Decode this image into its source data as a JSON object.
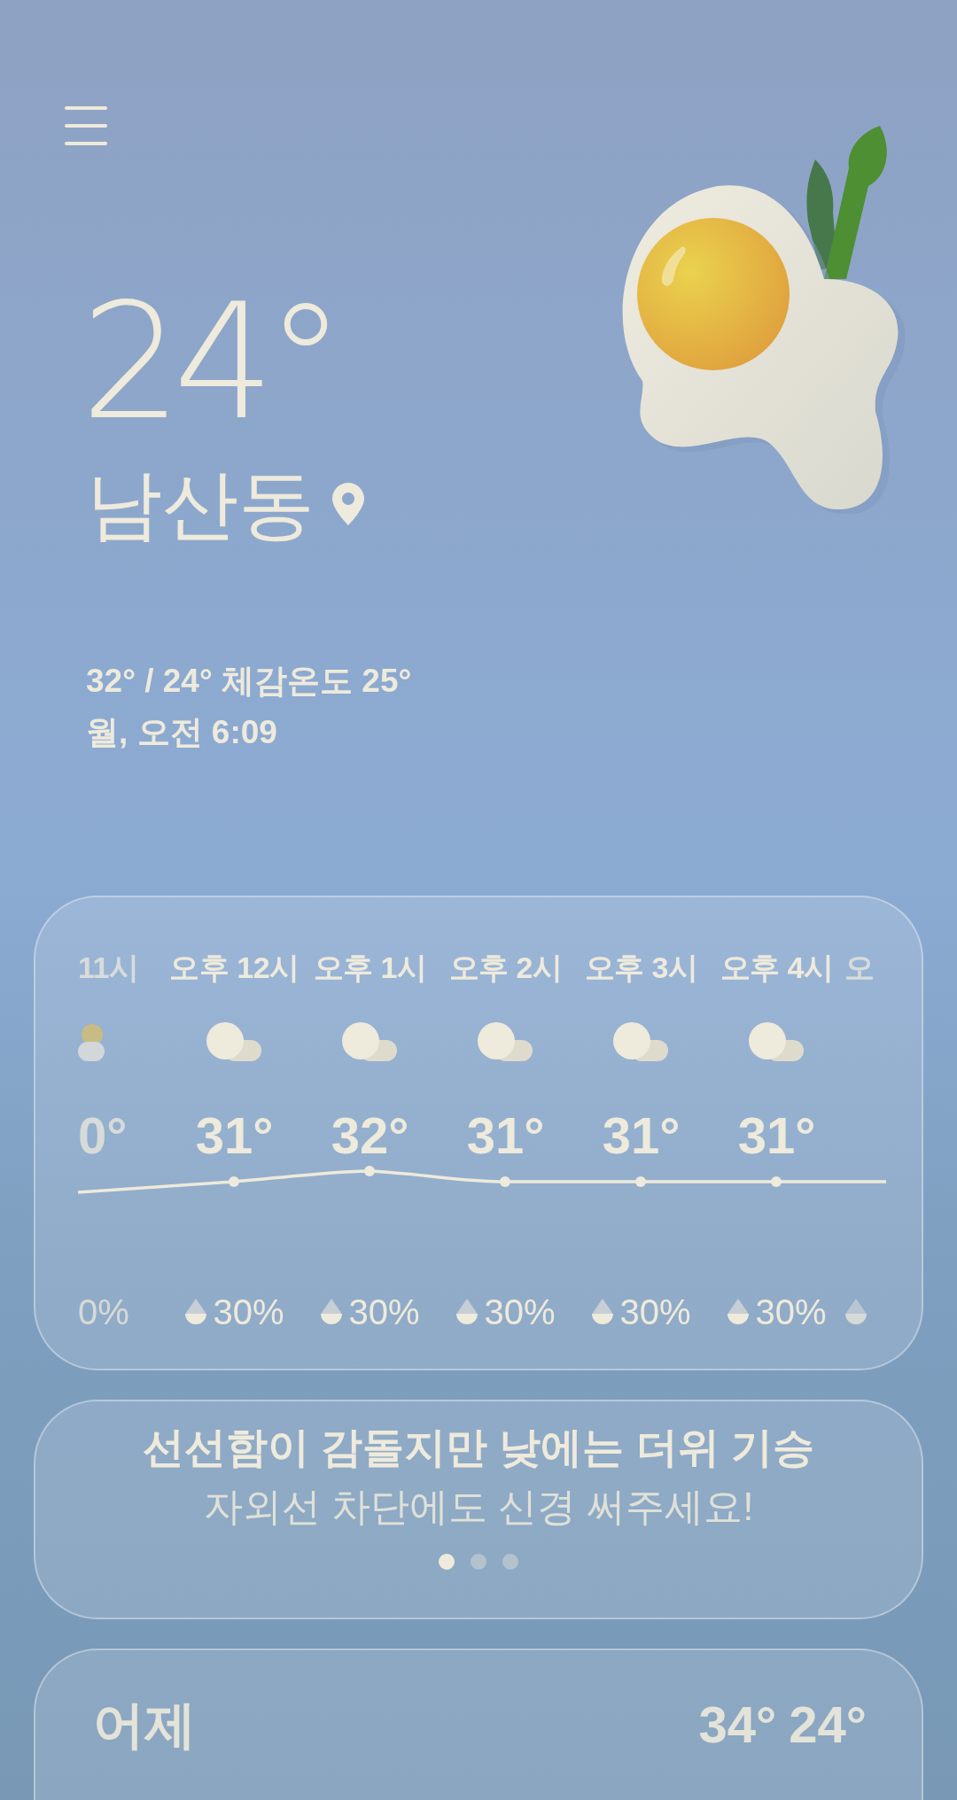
{
  "current": {
    "temperature": "24°",
    "location": "남산동",
    "high_low_feels": "32° / 24° 체감온도 25°",
    "updated": "월, 오전 6:09"
  },
  "hourly": [
    {
      "kind": "partlycloudy",
      "time": "11시",
      "temp": "0°",
      "precip": "0%"
    },
    {
      "kind": "cloudy",
      "time": "오후 12시",
      "temp": "31°",
      "precip": "30%"
    },
    {
      "kind": "cloudy",
      "time": "오후 1시",
      "temp": "32°",
      "precip": "30%"
    },
    {
      "kind": "cloudy",
      "time": "오후 2시",
      "temp": "31°",
      "precip": "30%"
    },
    {
      "kind": "cloudy",
      "time": "오후 3시",
      "temp": "31°",
      "precip": "30%"
    },
    {
      "kind": "cloudy",
      "time": "오후 4시",
      "temp": "31°",
      "precip": "30%"
    },
    {
      "time": "오"
    }
  ],
  "tip": {
    "title": "선선함이 감돌지만 낮에는 더위 기승",
    "subtitle": "자외선 차단에도 신경 써주세요!",
    "pages": [
      {
        "selected": true
      },
      {
        "selected": false
      },
      {
        "selected": false
      }
    ]
  },
  "yesterday": {
    "label": "어제",
    "high": "34°",
    "low": "24°"
  }
}
